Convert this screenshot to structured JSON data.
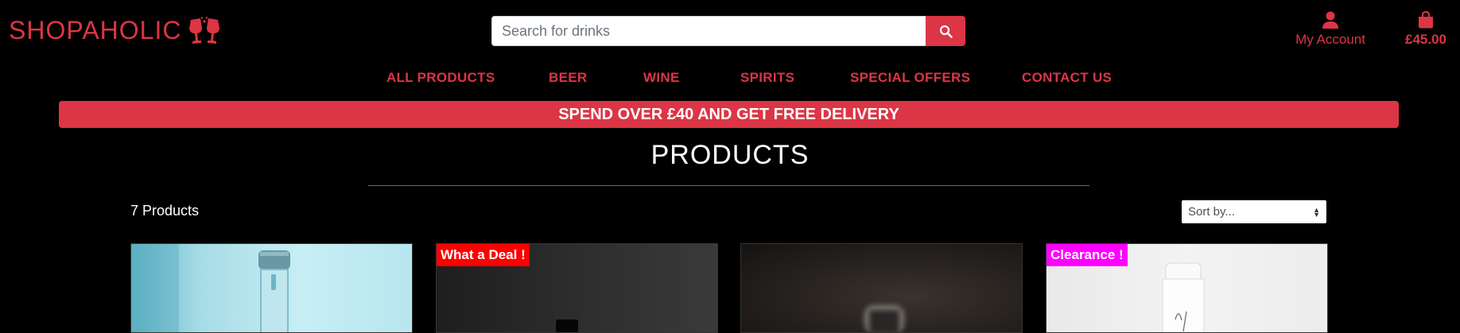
{
  "brand": {
    "name": "SHOPAHOLIC",
    "icon": "glasses-cheers-icon",
    "color": "#dc3545"
  },
  "search": {
    "placeholder": "Search for drinks",
    "value": "",
    "button_icon": "search-icon"
  },
  "account": {
    "label": "My Account",
    "icon": "user-icon"
  },
  "bag": {
    "total": "£45.00",
    "icon": "shopping-bag-icon"
  },
  "nav": {
    "items": [
      {
        "label": "ALL PRODUCTS"
      },
      {
        "label": "BEER"
      },
      {
        "label": "WINE"
      },
      {
        "label": "SPIRITS"
      },
      {
        "label": "SPECIAL OFFERS"
      },
      {
        "label": "CONTACT US"
      }
    ]
  },
  "banner": {
    "text": "SPEND OVER £40 AND GET FREE DELIVERY"
  },
  "page": {
    "title": "PRODUCTS",
    "count": "7 Products"
  },
  "sort": {
    "selected": "Sort by..."
  },
  "products": [
    {
      "badge": "",
      "image": "glass-bottle-blue"
    },
    {
      "badge": "What a Deal !",
      "badge_color": "#ff0000",
      "image": "dark-bottle"
    },
    {
      "badge": "",
      "image": "bottle-neck-blurred"
    },
    {
      "badge": "Clearance !",
      "badge_color": "#ff00ff",
      "image": "white-bottle"
    }
  ],
  "colors": {
    "accent": "#dc3545",
    "background": "#000000"
  }
}
